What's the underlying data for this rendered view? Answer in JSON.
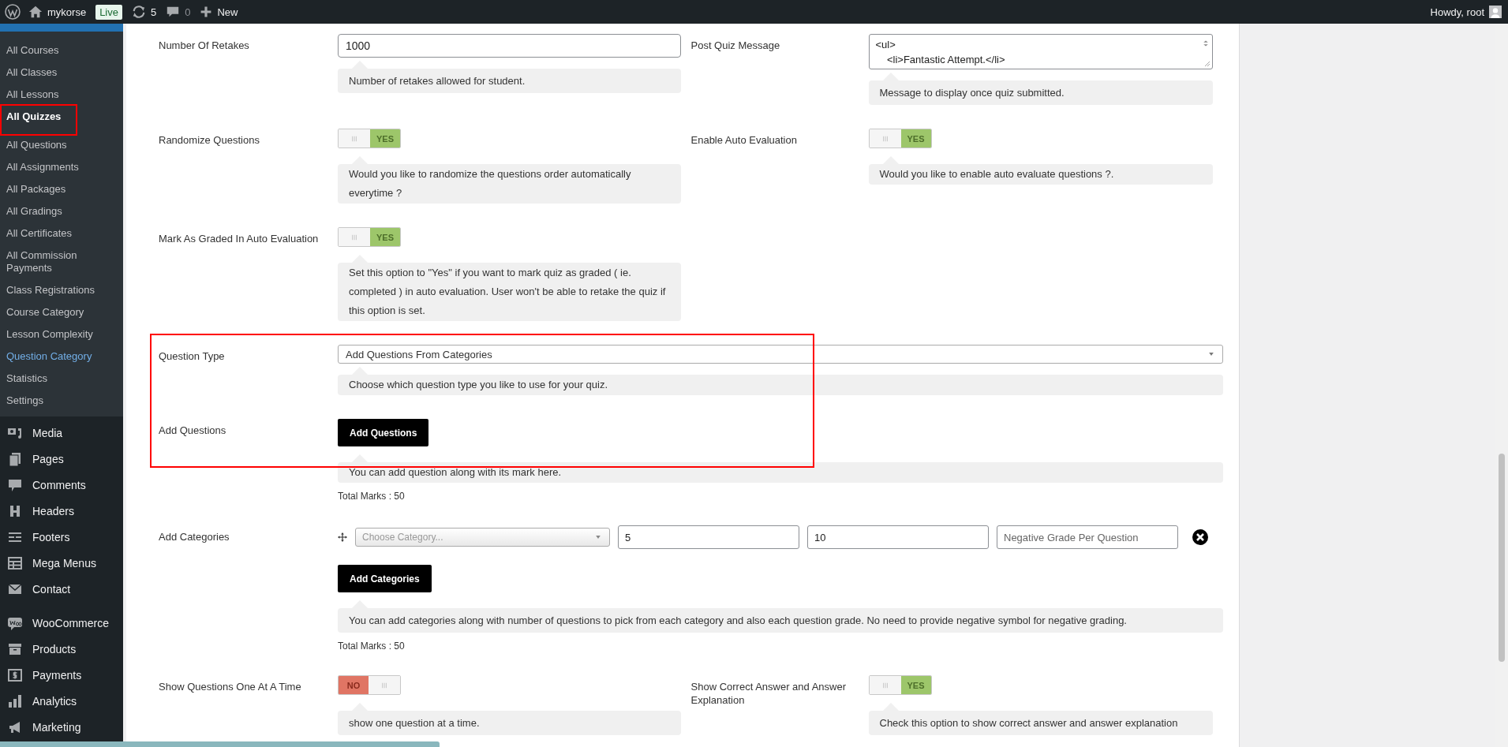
{
  "admin_bar": {
    "site_name": "mykorse",
    "site_badge": "Live",
    "updates": "5",
    "comments": "0",
    "new_label": "New",
    "greeting": "Howdy, root"
  },
  "sidebar": {
    "submenu": [
      {
        "label": "All Courses",
        "selected": false,
        "hovered": false,
        "highlighted": false
      },
      {
        "label": "All Classes",
        "selected": false,
        "hovered": false,
        "highlighted": false
      },
      {
        "label": "All Lessons",
        "selected": false,
        "hovered": false,
        "highlighted": false
      },
      {
        "label": "All Quizzes",
        "selected": true,
        "hovered": false,
        "highlighted": true
      },
      {
        "label": "All Questions",
        "selected": false,
        "hovered": false,
        "highlighted": false
      },
      {
        "label": "All Assignments",
        "selected": false,
        "hovered": false,
        "highlighted": false
      },
      {
        "label": "All Packages",
        "selected": false,
        "hovered": false,
        "highlighted": false
      },
      {
        "label": "All Gradings",
        "selected": false,
        "hovered": false,
        "highlighted": false
      },
      {
        "label": "All Certificates",
        "selected": false,
        "hovered": false,
        "highlighted": false
      },
      {
        "label": "All Commission Payments",
        "selected": false,
        "hovered": false,
        "highlighted": false
      },
      {
        "label": "Class Registrations",
        "selected": false,
        "hovered": false,
        "highlighted": false
      },
      {
        "label": "Course Category",
        "selected": false,
        "hovered": false,
        "highlighted": false
      },
      {
        "label": "Lesson Complexity",
        "selected": false,
        "hovered": false,
        "highlighted": false
      },
      {
        "label": "Question Category",
        "selected": false,
        "hovered": true,
        "highlighted": false
      },
      {
        "label": "Statistics",
        "selected": false,
        "hovered": false,
        "highlighted": false
      },
      {
        "label": "Settings",
        "selected": false,
        "hovered": false,
        "highlighted": false
      }
    ],
    "menu": [
      {
        "label": "Media",
        "kind": "media"
      },
      {
        "label": "Pages",
        "kind": "pages"
      },
      {
        "label": "Comments",
        "kind": "comments"
      },
      {
        "label": "Headers",
        "kind": "headers"
      },
      {
        "label": "Footers",
        "kind": "footers"
      },
      {
        "label": "Mega Menus",
        "kind": "table"
      },
      {
        "label": "Contact",
        "kind": "mail"
      },
      {
        "label": "WooCommerce",
        "kind": "woo"
      },
      {
        "label": "Products",
        "kind": "archive"
      },
      {
        "label": "Payments",
        "kind": "dollar"
      },
      {
        "label": "Analytics",
        "kind": "chart"
      },
      {
        "label": "Marketing",
        "kind": "megaphone"
      }
    ]
  },
  "form": {
    "rows": [
      {
        "kind": "pair",
        "highlighted": false,
        "fields": [
          {
            "kind": "text",
            "label": "Number Of Retakes",
            "value": "1000",
            "hint": "Number of retakes allowed for student."
          },
          {
            "kind": "textarea",
            "label": "Post Quiz Message",
            "value": "<ul>\n\t<li>Fantastic Attempt.</li>",
            "hint": "Message to display once quiz submitted."
          }
        ]
      },
      {
        "kind": "pair",
        "highlighted": false,
        "fields": [
          {
            "kind": "toggle",
            "label": "Randomize Questions",
            "on": true,
            "state_text": "YES",
            "hint": "Would you like to randomize the questions order automatically everytime ?"
          },
          {
            "kind": "toggle",
            "label": "Enable Auto Evaluation",
            "on": true,
            "state_text": "YES",
            "hint": "Would you like to enable auto evaluate questions ?."
          }
        ]
      },
      {
        "kind": "pair",
        "highlighted": false,
        "fields": [
          {
            "kind": "toggle",
            "label": "Mark As Graded In Auto Evaluation",
            "on": true,
            "state_text": "YES",
            "hint": "Set this option to \"Yes\" if you want to mark quiz as graded ( ie. completed ) in auto evaluation. User won't be able to retake the quiz if this option is set."
          }
        ]
      },
      {
        "kind": "full",
        "highlighted": true,
        "fields": [
          {
            "kind": "select",
            "label": "Question Type",
            "value": "Add Questions From Categories",
            "hint": "Choose which question type you like to use for your quiz."
          }
        ]
      },
      {
        "kind": "full",
        "highlighted": true,
        "fields": [
          {
            "kind": "button",
            "label": "Add Questions",
            "button_label": "Add Questions",
            "hint": "You can add question along with its mark here.",
            "total": "Total Marks : 50"
          }
        ]
      },
      {
        "kind": "full",
        "highlighted": false,
        "fields": [
          {
            "kind": "categories",
            "label": "Add Categories",
            "category_rows": [
              {
                "category_placeholder": "Choose Category...",
                "questions": "5",
                "grade": "10",
                "negative_placeholder": "Negative Grade Per Question"
              }
            ],
            "button_label": "Add Categories",
            "hint": "You can add categories along with number of questions to pick from each category and also each question grade. No need to provide negative symbol for negative grading.",
            "total": "Total Marks : 50"
          }
        ]
      },
      {
        "kind": "pair",
        "highlighted": false,
        "fields": [
          {
            "kind": "toggle",
            "label": "Show Questions One At A Time",
            "on": false,
            "state_text": "NO",
            "hint": "show one question at a time."
          },
          {
            "kind": "toggle",
            "label": "Show Correct Answer and Answer Explanation",
            "on": true,
            "state_text": "YES",
            "hint": "Check this option to show correct answer and answer explanation"
          }
        ]
      }
    ]
  }
}
